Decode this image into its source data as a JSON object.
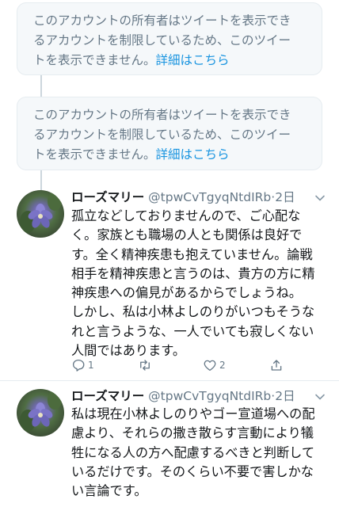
{
  "withheld": [
    {
      "lines": [
        "このアカウントの所有者はツイートを表示でき",
        "るアカウントを制限しているため、このツイー",
        "トを表示できません。"
      ],
      "link": "詳細はこちら"
    },
    {
      "lines": [
        "このアカウントの所有者はツイートを表示でき",
        "るアカウントを制限しているため、このツイー",
        "トを表示できません。"
      ],
      "link": "詳細はこちら"
    }
  ],
  "tweets": [
    {
      "name": "ローズマリー",
      "handle": "@tpwCvTgyqNtdIRb",
      "separator": "·",
      "time": "2日",
      "lines": [
        "孤立などしておりませんので、ご心配な",
        "く。家族とも職場の人とも関係は良好で",
        "す。全く精神疾患も抱えていません。論戦",
        "相手を精神疾患と言うのは、貴方の方に精",
        "神疾患への偏見があるからでしょうね。",
        "しかし、私は小林よしのりがいつもそうな",
        "れと言うような、一人でいても寂しくない",
        "人間ではあります。"
      ],
      "reply_count": "1",
      "retweet_count": "",
      "like_count": "2"
    },
    {
      "name": "ローズマリー",
      "handle": "@tpwCvTgyqNtdIRb",
      "separator": "·",
      "time": "2日",
      "lines": [
        "私は現在小林よしのりやゴー宣道場への配",
        "慮より、それらの撒き散らす言動により犠",
        "牲になる人の方へ配慮するべきと判断して",
        "いるだけです。そのくらい不要で害しかな",
        "い言論です。"
      ]
    }
  ],
  "colors": {
    "text": "#14171a",
    "secondary": "#657786",
    "link": "#1b95e0",
    "card_bg": "#f5f8fa",
    "border": "#e6ecf0",
    "thread_line": "#ccd6dd"
  }
}
